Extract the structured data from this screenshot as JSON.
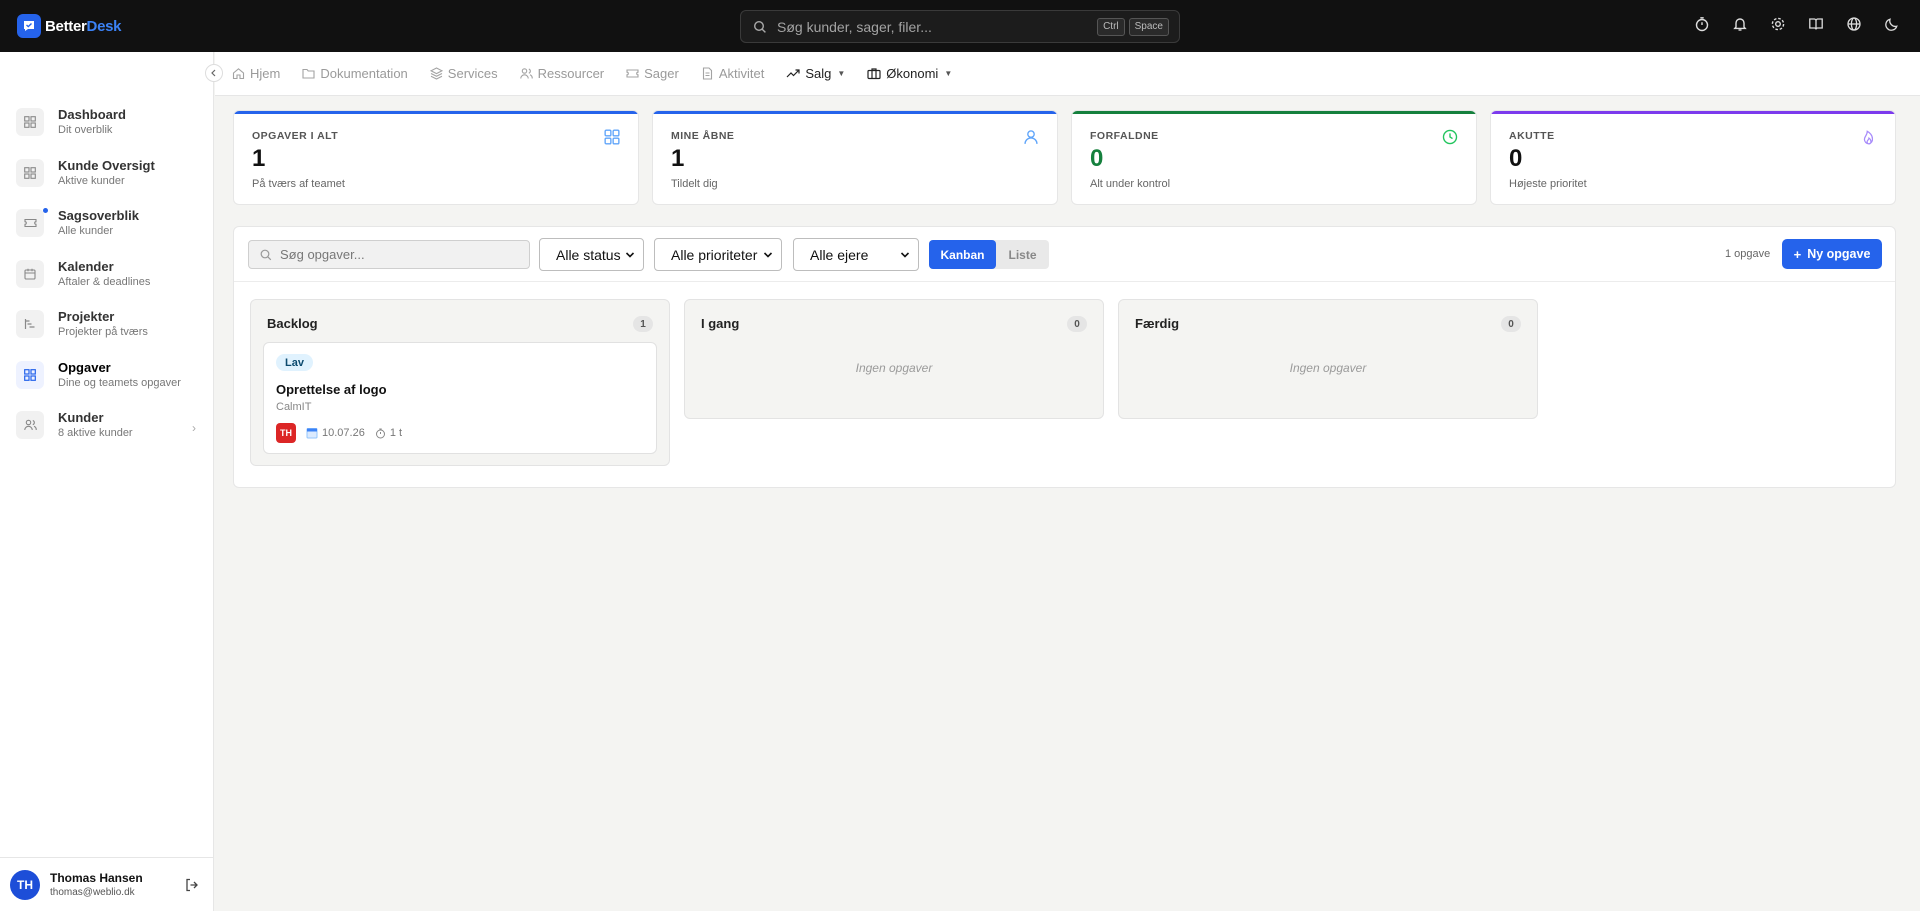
{
  "brand": {
    "part1": "Better",
    "part2": "Desk"
  },
  "global_search": {
    "placeholder": "Søg kunder, sager, filer...",
    "kbd1": "Ctrl",
    "kbd2": "Space"
  },
  "top_icons": [
    "timer-icon",
    "bell-icon",
    "gear-icon",
    "book-icon",
    "globe-icon",
    "moon-icon"
  ],
  "sidebar": {
    "items": [
      {
        "label": "Dashboard",
        "sub": "Dit overblik",
        "icon": "grid-icon"
      },
      {
        "label": "Kunde Oversigt",
        "sub": "Aktive kunder",
        "icon": "grid-icon"
      },
      {
        "label": "Sagsoverblik",
        "sub": "Alle kunder",
        "icon": "ticket-icon",
        "dot": true
      },
      {
        "label": "Kalender",
        "sub": "Aftaler & deadlines",
        "icon": "calendar-icon"
      },
      {
        "label": "Projekter",
        "sub": "Projekter på tværs",
        "icon": "project-icon"
      },
      {
        "label": "Opgaver",
        "sub": "Dine og teamets opgaver",
        "icon": "grid-icon",
        "active": true
      },
      {
        "label": "Kunder",
        "sub": "8 aktive kunder",
        "icon": "users-icon",
        "chevron": true
      }
    ]
  },
  "user": {
    "initials": "TH",
    "name": "Thomas Hansen",
    "email": "thomas@weblio.dk"
  },
  "subnav": {
    "tabs": [
      {
        "label": "Hjem",
        "icon": "home-icon"
      },
      {
        "label": "Dokumentation",
        "icon": "folder-icon"
      },
      {
        "label": "Services",
        "icon": "layers-icon"
      },
      {
        "label": "Ressourcer",
        "icon": "users-icon"
      },
      {
        "label": "Sager",
        "icon": "ticket-icon"
      },
      {
        "label": "Aktivitet",
        "icon": "document-icon"
      },
      {
        "label": "Salg",
        "icon": "trend-icon"
      },
      {
        "label": "Økonomi",
        "icon": "briefcase-icon"
      }
    ]
  },
  "stats": [
    {
      "label": "OPGAVER I ALT",
      "value": "1",
      "sub": "På tværs af teamet",
      "accent": "#2563eb",
      "value_color": "#111111",
      "icon": "grid-icon"
    },
    {
      "label": "MINE ÅBNE",
      "value": "1",
      "sub": "Tildelt dig",
      "accent": "#2563eb",
      "value_color": "#111111",
      "icon": "user-icon"
    },
    {
      "label": "FORFALDNE",
      "value": "0",
      "sub": "Alt under kontrol",
      "accent": "#15803d",
      "value_color": "#15803d",
      "icon": "clock-icon"
    },
    {
      "label": "AKUTTE",
      "value": "0",
      "sub": "Højeste prioritet",
      "accent": "#7c3aed",
      "value_color": "#111111",
      "icon": "flame-icon"
    }
  ],
  "toolbar": {
    "search_placeholder": "Søg opgaver...",
    "status_filter": "Alle status",
    "priority_filter": "Alle prioriteter",
    "owner_filter": "Alle ejere",
    "view_kanban": "Kanban",
    "view_list": "Liste",
    "count": "1 opgave",
    "new_button": "Ny opgave"
  },
  "board": {
    "columns": [
      {
        "title": "Backlog",
        "count": "1",
        "empty": ""
      },
      {
        "title": "I gang",
        "count": "0",
        "empty": "Ingen opgaver"
      },
      {
        "title": "Færdig",
        "count": "0",
        "empty": "Ingen opgaver"
      }
    ],
    "card": {
      "priority": "Lav",
      "title": "Oprettelse af logo",
      "customer": "CalmIT",
      "assignee": "TH",
      "date": "10.07.26",
      "estimate": "1 t"
    }
  }
}
